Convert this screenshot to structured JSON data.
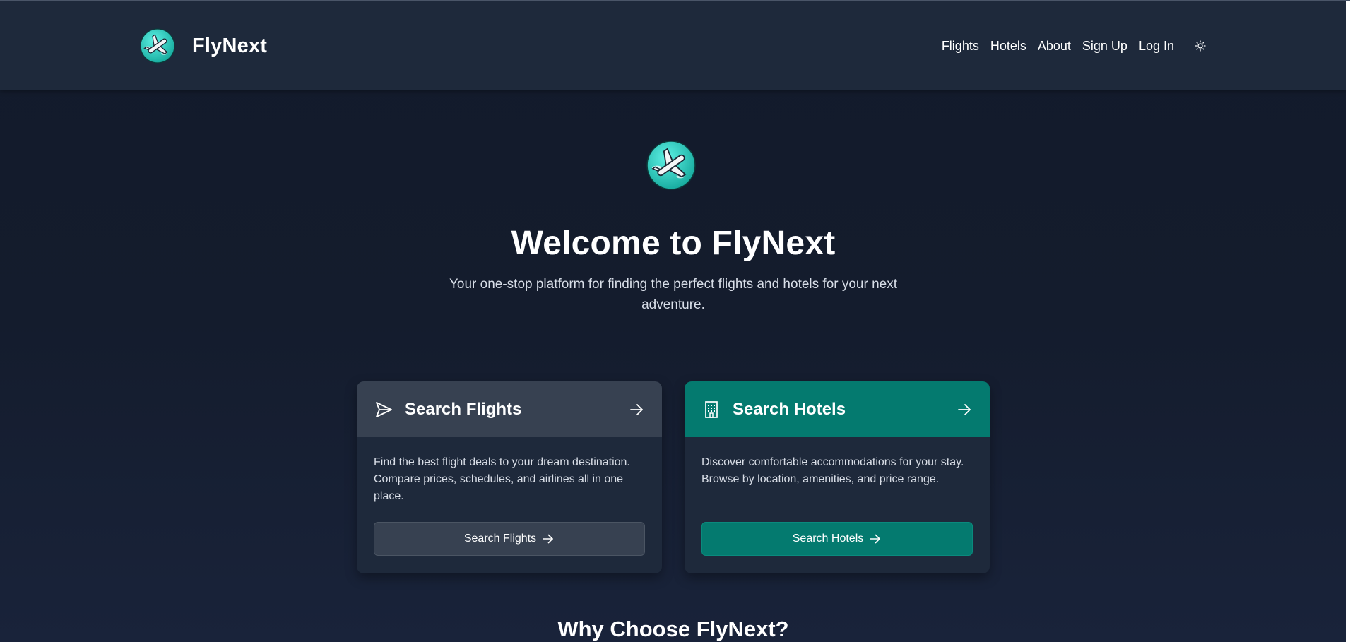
{
  "brand": {
    "name": "FlyNext",
    "logo_icon": "plane-logo-icon"
  },
  "nav": {
    "items": [
      {
        "label": "Flights"
      },
      {
        "label": "Hotels"
      },
      {
        "label": "About"
      },
      {
        "label": "Sign Up"
      },
      {
        "label": "Log In"
      }
    ],
    "theme_toggle_icon": "sun-icon"
  },
  "hero": {
    "title": "Welcome to FlyNext",
    "subtitle": "Your one-stop platform for finding the perfect flights and hotels for your next adventure."
  },
  "cards": {
    "flights": {
      "title": "Search Flights",
      "icon": "paper-plane-icon",
      "description": "Find the best flight deals to your dream destination. Compare prices, schedules, and airlines all in one place.",
      "button_label": "Search Flights",
      "header_color": "#374151"
    },
    "hotels": {
      "title": "Search Hotels",
      "icon": "building-icon",
      "description": "Discover comfortable accommodations for your stay. Browse by location, amenities, and price range.",
      "button_label": "Search Hotels",
      "header_color": "#047a6f"
    }
  },
  "why": {
    "title": "Why Choose FlyNext?"
  },
  "colors": {
    "background": "#131a2a",
    "navbar": "#1e293b",
    "accent_teal": "#047a6f",
    "card_gray": "#374151"
  }
}
